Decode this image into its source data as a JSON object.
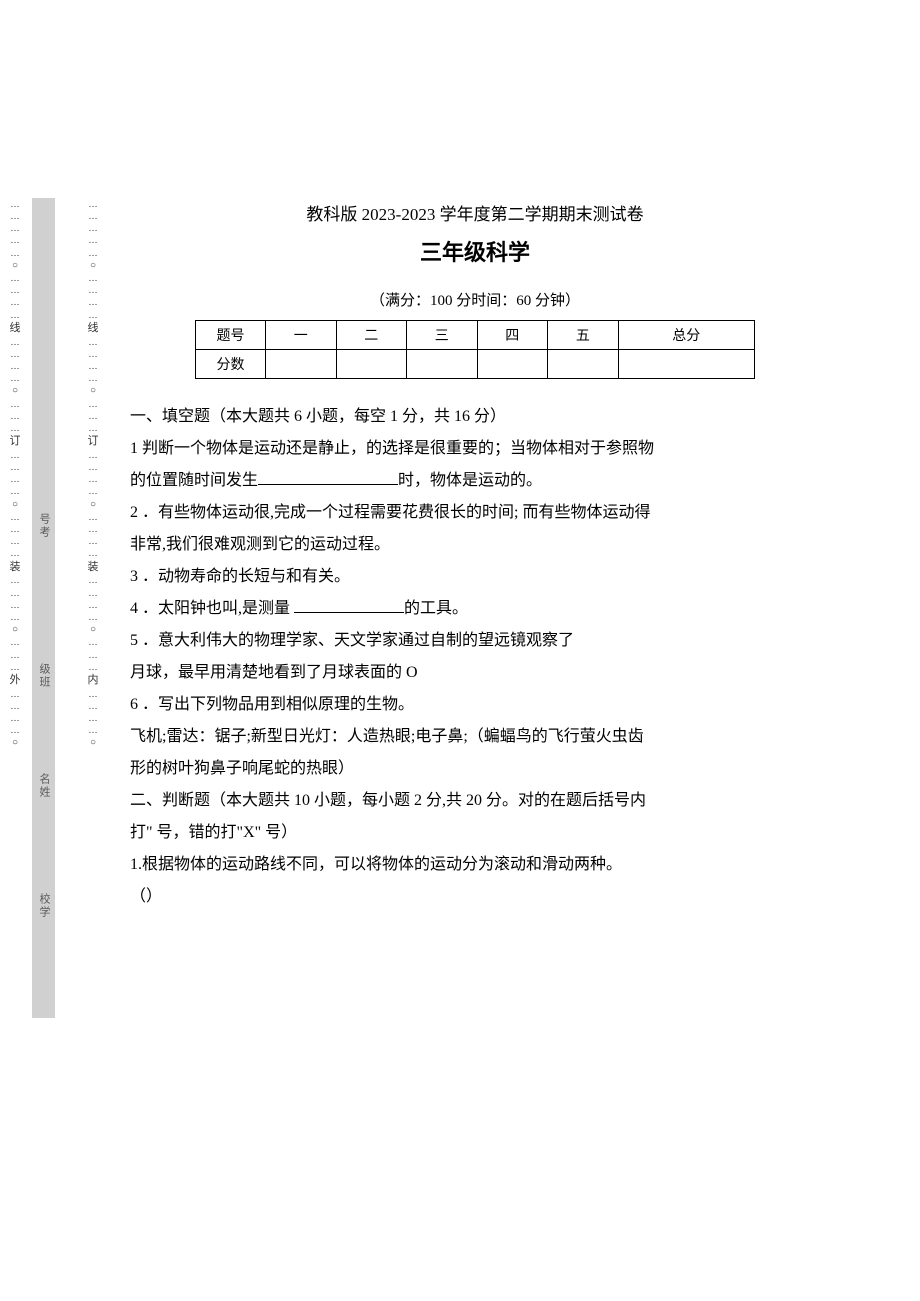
{
  "header": {
    "line1": "教科版 2023-2023 学年度第二学期期末测试卷",
    "line2": "三年级科学",
    "meta": "（满分：100 分时间：60 分钟）"
  },
  "score_table": {
    "row_labels": [
      "题号",
      "分数"
    ],
    "cols": [
      "一",
      "二",
      "三",
      "四",
      "五",
      "总分"
    ]
  },
  "sections": {
    "s1_heading": "一、填空题（本大题共 6 小题，每空 1 分，共 16 分）",
    "q1a": "1 判断一个物体是运动还是静止，的选择是很重要的；当物体相对于参照物",
    "q1b_pre": "的位置随时间发生",
    "q1b_post": "时，物体是运动的。",
    "q2a": "2  ．有些物体运动很,完成一个过程需要花费很长的时间; 而有些物体运动得",
    "q2b": "非常,我们很难观测到它的运动过程。",
    "q3": "3  ．动物寿命的长短与和有关。",
    "q4_pre": "4  ．太阳钟也叫,是测量 ",
    "q4_post": "的工具。",
    "q5a": "5  ．意大利伟大的物理学家、天文学家通过自制的望远镜观察了",
    "q5b": "月球，最早用清楚地看到了月球表面的 O",
    "q6a": "6  ．写出下列物品用到相似原理的生物。",
    "q6b": "飞机;雷达：锯子;新型日光灯：人造热眼;电子鼻;（蝙蝠鸟的飞行萤火虫齿",
    "q6c": "形的树叶狗鼻子响尾蛇的热眼）",
    "s2_heading_a": "二、判断题（本大题共 10 小题，每小题 2 分,共 20 分。对的在题后括号内",
    "s2_heading_b": "打\" 号，错的打\"X\" 号）",
    "j1a": "1.根据物体的运动路线不同，可以将物体的运动分为滚动和滑动两种。",
    "j1b": "（）"
  },
  "margin": {
    "col_outer_chars": [
      "线",
      "订",
      "装",
      "外"
    ],
    "col_inner_chars": [
      "线",
      "订",
      "装",
      "内"
    ],
    "strip_labels_top_to_bottom": [
      "号考",
      "级班",
      "名姓",
      "校学"
    ]
  }
}
